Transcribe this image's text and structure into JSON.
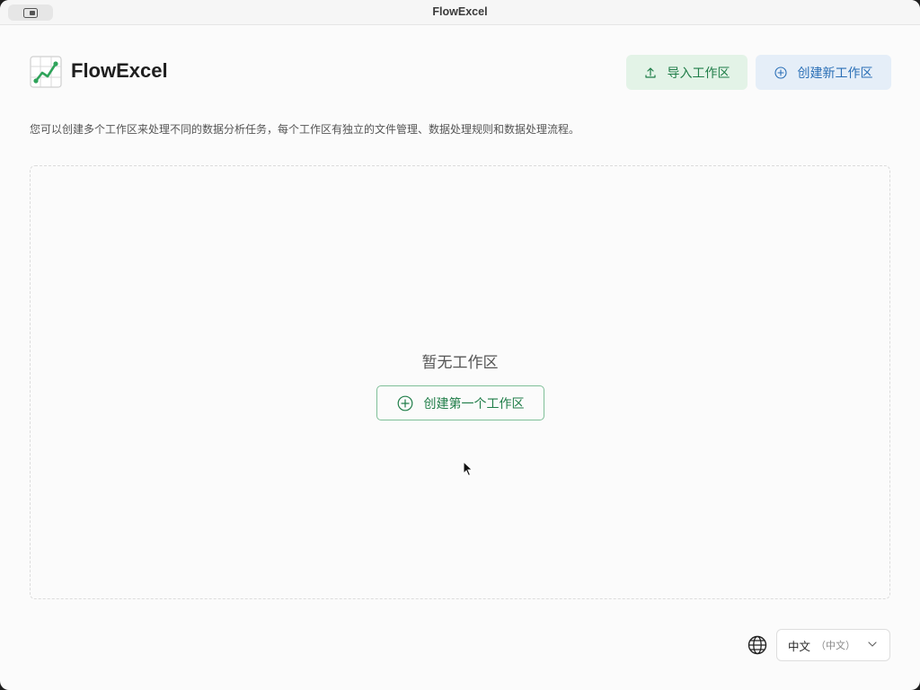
{
  "window": {
    "title": "FlowExcel"
  },
  "header": {
    "app_name": "FlowExcel",
    "import_label": "导入工作区",
    "create_label": "创建新工作区"
  },
  "description": "您可以创建多个工作区来处理不同的数据分析任务，每个工作区有独立的文件管理、数据处理规则和数据处理流程。",
  "empty_state": {
    "title": "暂无工作区",
    "create_first_label": "创建第一个工作区"
  },
  "language": {
    "selected": "中文",
    "selected_native": "（中文）"
  },
  "colors": {
    "green_accent": "#1f7d48",
    "blue_accent": "#2a6fb6",
    "import_bg": "#e3f3e7",
    "create_bg": "#e5eef8"
  },
  "icons": {
    "logo": "chart-grid-logo-icon",
    "import": "upload-icon",
    "create": "plus-circle-icon",
    "language": "globe-icon",
    "dropdown": "chevron-down-icon"
  }
}
